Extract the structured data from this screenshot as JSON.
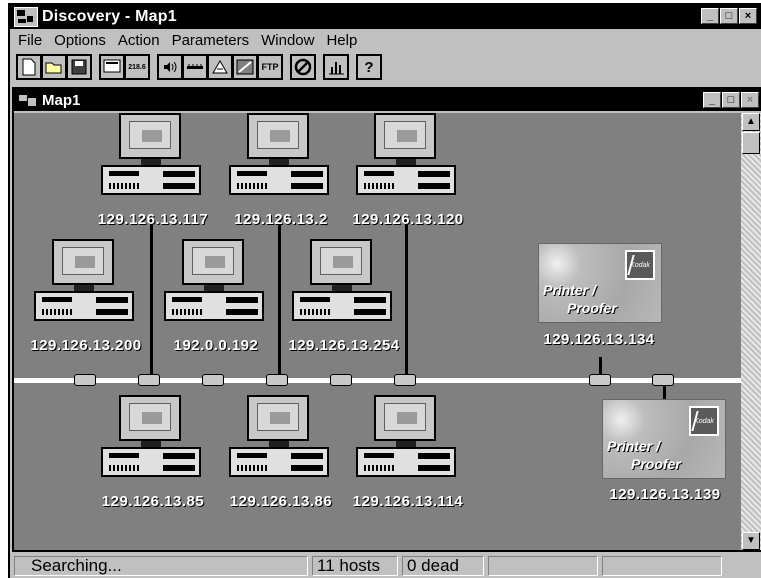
{
  "window": {
    "title": "Discovery - Map1",
    "min": "_",
    "max": "□",
    "close": "×"
  },
  "menu": [
    "File",
    "Options",
    "Action",
    "Parameters",
    "Window",
    "Help"
  ],
  "toolbar": {
    "groups": [
      [
        "new-file-icon",
        "open-folder-icon",
        "save-disk-icon"
      ],
      [
        "ping-icon",
        "subnet-icon"
      ],
      [
        "sound-icon",
        "bandwidth-icon",
        "route-icon",
        "monitor-icon",
        "ftp-icon"
      ],
      [
        "stop-icon"
      ],
      [
        "statistics-icon"
      ],
      [
        "help-icon"
      ]
    ],
    "subnet_label": "218.6",
    "ftp_label": "FTP"
  },
  "map_window": {
    "title": "Map1"
  },
  "hosts": [
    {
      "ip": "129.126.13.117"
    },
    {
      "ip": "129.126.13.2"
    },
    {
      "ip": "129.126.13.120"
    },
    {
      "ip": "129.126.13.200"
    },
    {
      "ip": "192.0.0.192"
    },
    {
      "ip": "129.126.13.254"
    },
    {
      "ip": "129.126.13.85"
    },
    {
      "ip": "129.126.13.86"
    },
    {
      "ip": "129.126.13.114"
    }
  ],
  "printers": [
    {
      "ip": "129.126.13.134",
      "line1": "Printer /",
      "line2": "Proofer",
      "logo": "Kodak"
    },
    {
      "ip": "129.126.13.139",
      "line1": "Printer /",
      "line2": "Proofer",
      "logo": "Kodak"
    }
  ],
  "status": {
    "text": "Searching...",
    "hosts": "11 hosts",
    "dead": "0 dead"
  }
}
